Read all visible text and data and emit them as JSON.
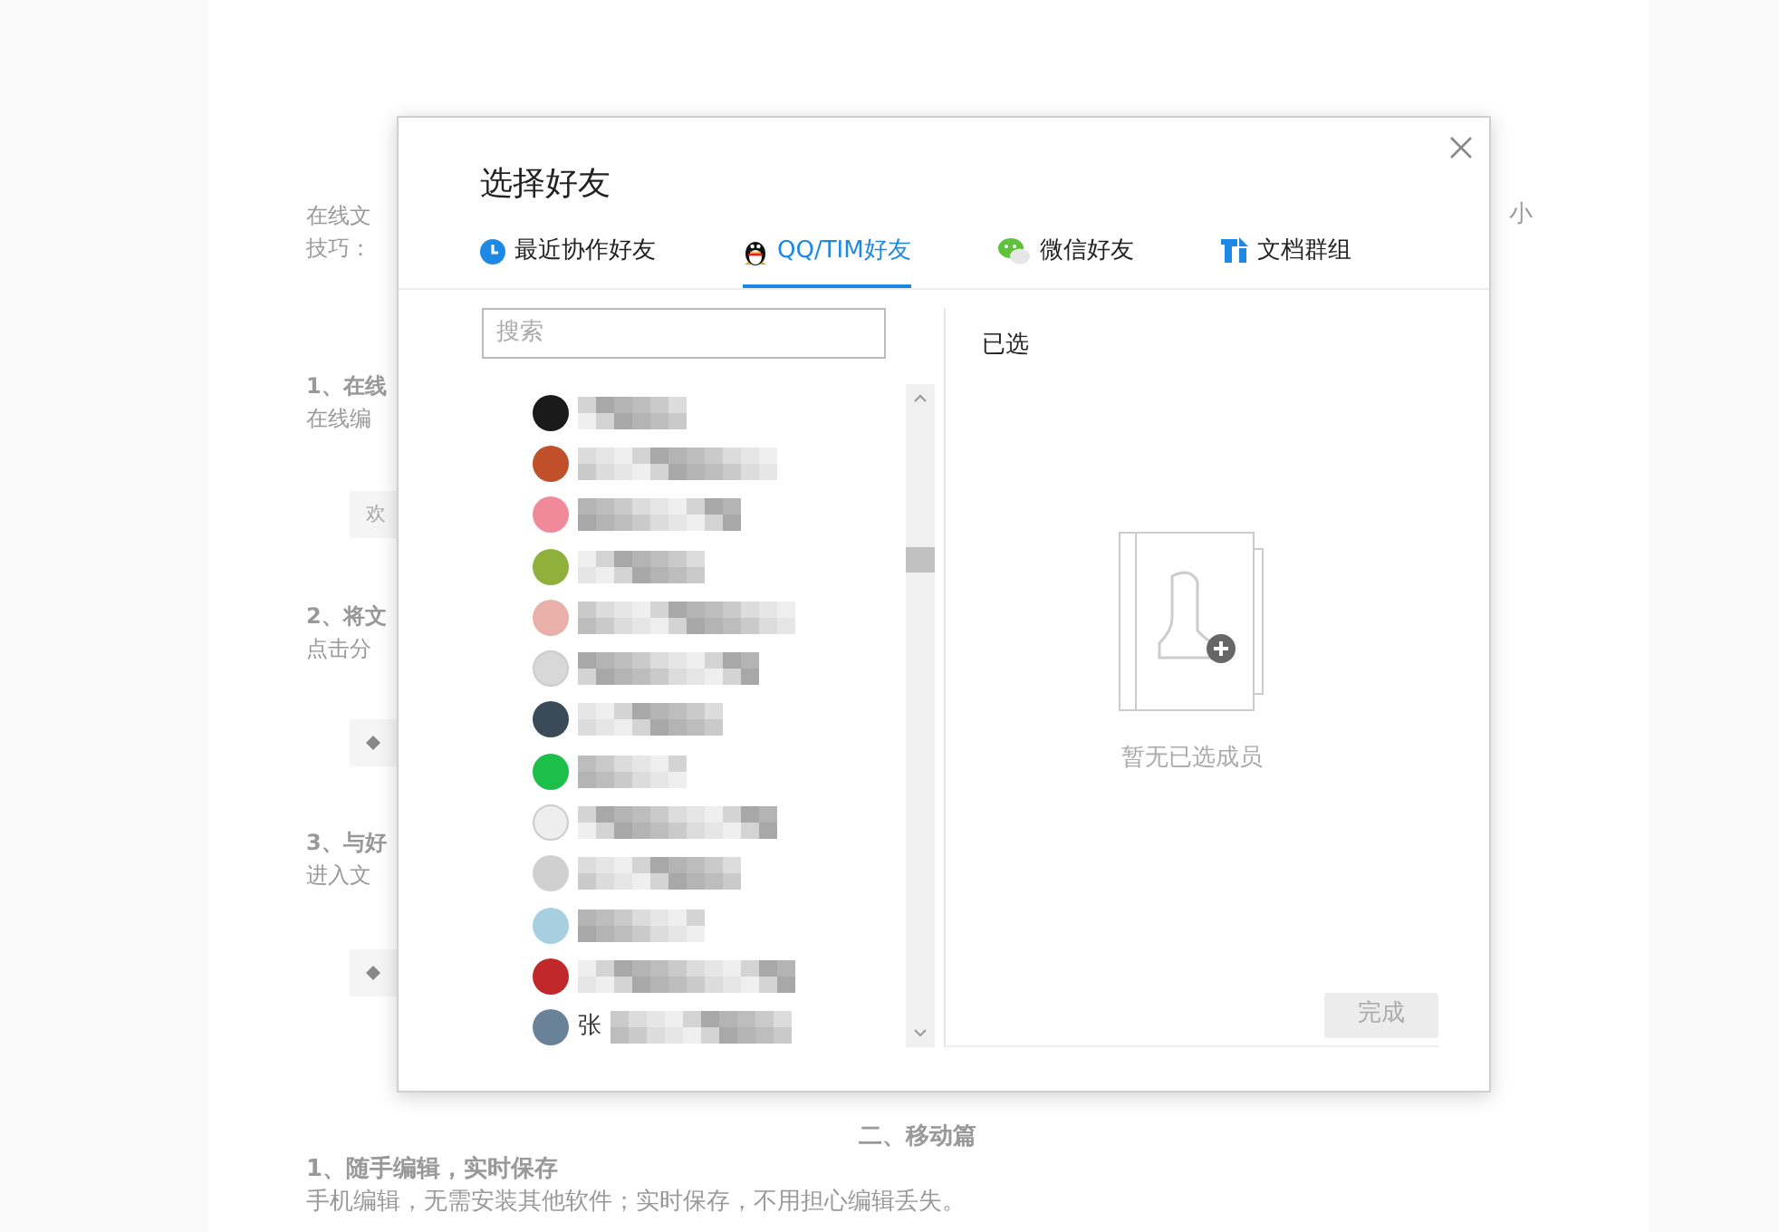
{
  "document": {
    "intro": {
      "left": "在线文",
      "right": "小"
    },
    "intro_2": "技巧：",
    "sections": [
      {
        "heading": "1、在线",
        "body": "在线编",
        "preview": {
          "kind": "text",
          "text": "欢"
        }
      },
      {
        "heading": "2、将文",
        "body": "点击分",
        "preview": {
          "kind": "icon"
        }
      },
      {
        "heading": "3、与好",
        "body": "进入文",
        "preview": {
          "kind": "icon"
        }
      }
    ],
    "part_title": "二、移动篇",
    "mobile": {
      "heading": "1、随手编辑，实时保存",
      "body": "手机编辑，无需安装其他软件；实时保存，不用担心编辑丢失。"
    }
  },
  "dialog": {
    "title": "选择好友",
    "tabs": [
      {
        "label": "最近协作好友",
        "kind": "clock",
        "selected": false
      },
      {
        "label": "QQ/TIM好友",
        "kind": "penguin",
        "selected": true
      },
      {
        "label": "微信好友",
        "kind": "chat",
        "selected": false
      },
      {
        "label": "文档群组",
        "kind": "docs",
        "selected": false
      }
    ],
    "search": {
      "placeholder": "搜索"
    },
    "friends": [
      {
        "color": "#1a1a1a"
      },
      {
        "color": "#c0502a"
      },
      {
        "color": "#f08a9a"
      },
      {
        "color": "#8fb03a"
      },
      {
        "color": "#e8b0a8"
      },
      {
        "color": "#d8d8d8"
      },
      {
        "color": "#3a4a58"
      },
      {
        "color": "#1cbf4a"
      },
      {
        "color": "#eeeeee"
      },
      {
        "color": "#d0d0d0"
      },
      {
        "color": "#a8cfe0"
      },
      {
        "color": "#c0282a"
      },
      {
        "color": "#6a8298",
        "name": "张"
      }
    ],
    "selected_panel": {
      "heading": "已选",
      "empty_text": "暂无已选成员"
    },
    "done_button": {
      "label": "完成",
      "disabled": true
    }
  }
}
